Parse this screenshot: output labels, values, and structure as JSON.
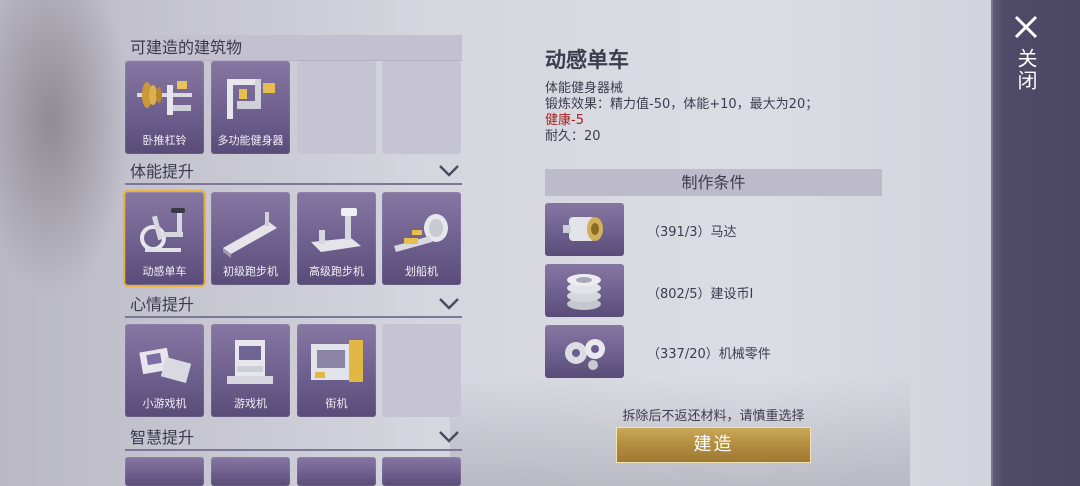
{
  "panel": {
    "buildable_title": "可建造的建筑物",
    "top_items": [
      {
        "label": "卧推杠铃",
        "icon": "barbell-bench-icon"
      },
      {
        "label": "多功能健身器",
        "icon": "multi-gym-icon"
      }
    ],
    "categories": [
      {
        "title": "体能提升",
        "items": [
          {
            "label": "动感单车",
            "icon": "exercise-bike-icon",
            "selected": true
          },
          {
            "label": "初级跑步机",
            "icon": "basic-treadmill-icon"
          },
          {
            "label": "高级跑步机",
            "icon": "advanced-treadmill-icon"
          },
          {
            "label": "划船机",
            "icon": "rowing-machine-icon"
          }
        ]
      },
      {
        "title": "心情提升",
        "items": [
          {
            "label": "小游戏机",
            "icon": "handheld-console-icon"
          },
          {
            "label": "游戏机",
            "icon": "arcade-cabinet-icon"
          },
          {
            "label": "街机",
            "icon": "arcade-machine-icon"
          }
        ]
      },
      {
        "title": "智慧提升",
        "items": []
      }
    ]
  },
  "detail": {
    "title": "动感单车",
    "type": "体能健身器械",
    "effect": "锻炼效果：精力值-50，体能+10，最大为20；",
    "health": "健康-5",
    "durability": "耐久：20"
  },
  "requirements": {
    "title": "制作条件",
    "items": [
      {
        "text": "（391/3）马达",
        "icon": "motor-icon"
      },
      {
        "text": "（802/5）建设币I",
        "icon": "coin-stack-icon"
      },
      {
        "text": "（337/20）机械零件",
        "icon": "gears-icon"
      }
    ]
  },
  "warning": "拆除后不返还材料，请慎重选择",
  "build_label": "建造",
  "close_label": "关闭",
  "colors": {
    "slot_purple": "#6c5e8c",
    "selected_border": "#e9b23d",
    "build_gold": "#b08a3e",
    "health_red": "#a02323"
  }
}
